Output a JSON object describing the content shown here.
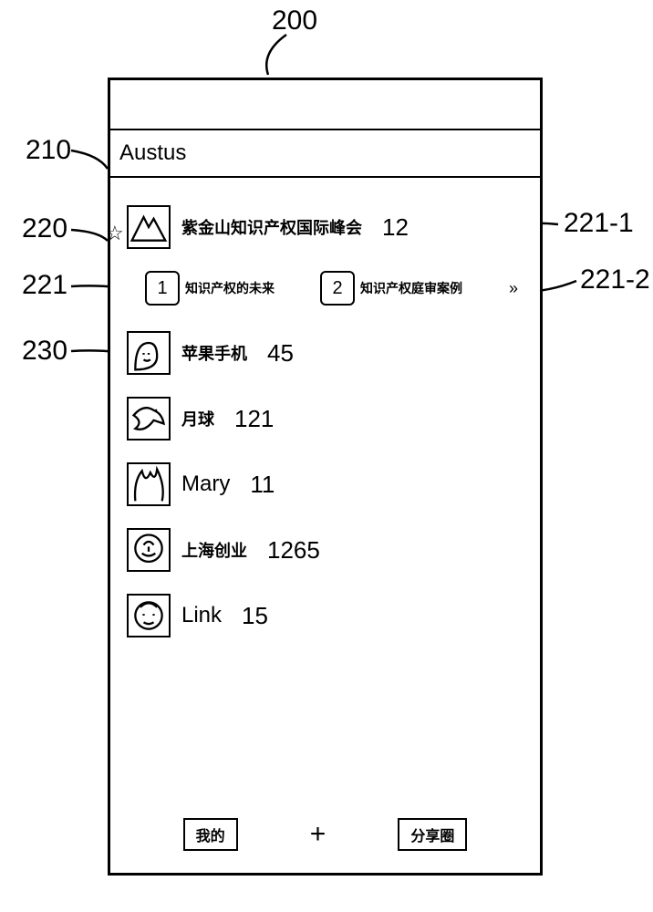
{
  "callouts": {
    "top": "200",
    "left_210": "210",
    "left_220": "220",
    "left_221": "221",
    "left_230": "230",
    "right_221_1": "221-1",
    "right_221_2": "221-2"
  },
  "title": "Austus",
  "featured": {
    "label": "紫金山知识产权国际峰会",
    "count": "12"
  },
  "sub_items": [
    {
      "num": "1",
      "label": "知识产权的未来"
    },
    {
      "num": "2",
      "label": "知识产权庭审案例"
    }
  ],
  "rows": [
    {
      "label": "苹果手机",
      "count": "45"
    },
    {
      "label": "月球",
      "count": "121"
    },
    {
      "label": "Mary",
      "count": "11"
    },
    {
      "label": "上海创业",
      "count": "1265"
    },
    {
      "label": "Link",
      "count": "15"
    }
  ],
  "bottom": {
    "left": "我的",
    "center": "+",
    "right": "分享圈"
  }
}
